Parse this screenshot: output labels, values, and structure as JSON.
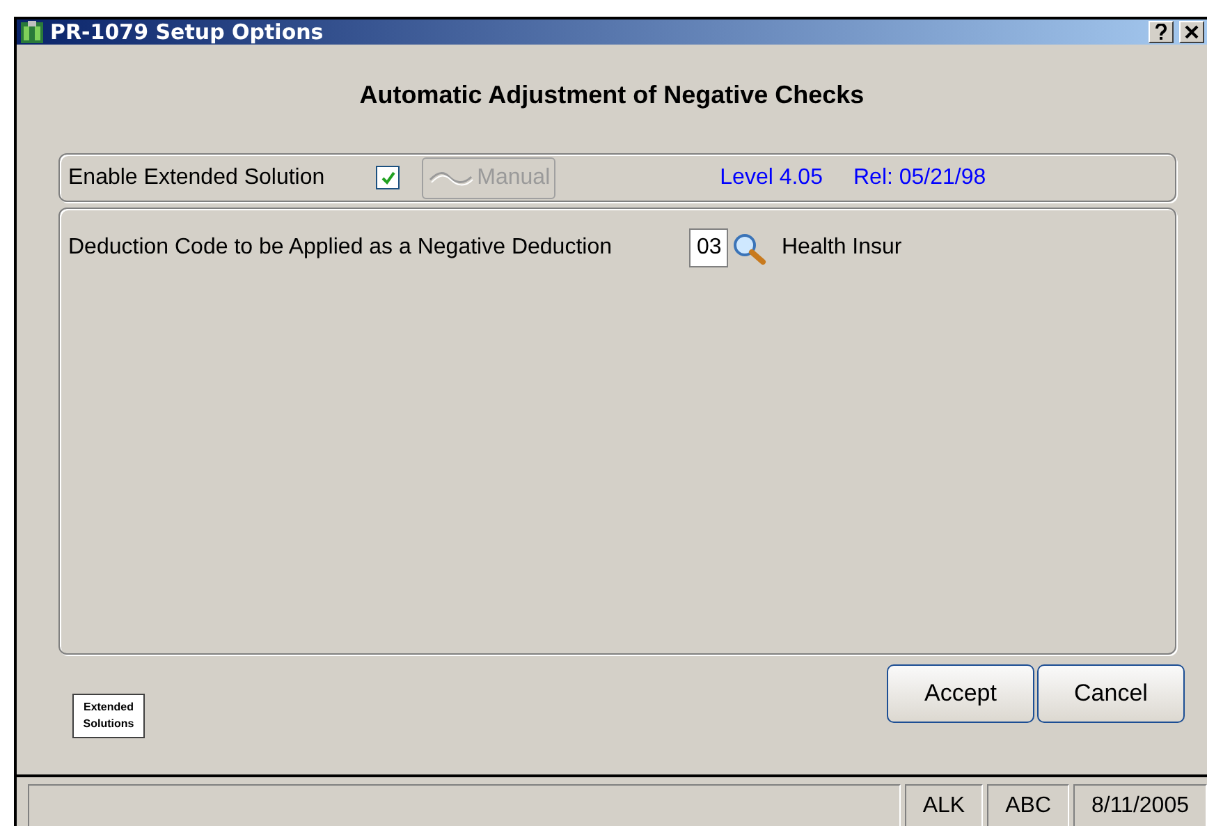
{
  "window": {
    "title": "PR-1079  Setup Options"
  },
  "heading": "Automatic Adjustment of Negative Checks",
  "options": {
    "enable_label": "Enable Extended Solution",
    "enable_checked": true,
    "manual_button": {
      "label": "Manual",
      "disabled": true
    },
    "level": "Level 4.05",
    "release": "Rel: 05/21/98"
  },
  "deduction": {
    "label": "Deduction Code to be Applied as a Negative Deduction",
    "code": "03",
    "description": "Health Insur"
  },
  "logo": {
    "line_1": "Extended",
    "line_2": "Solutions"
  },
  "buttons": [
    {
      "label": "Accept"
    },
    {
      "label": "Cancel"
    }
  ],
  "status_bar": [
    "ALK",
    "ABC",
    "8/11/2005"
  ]
}
